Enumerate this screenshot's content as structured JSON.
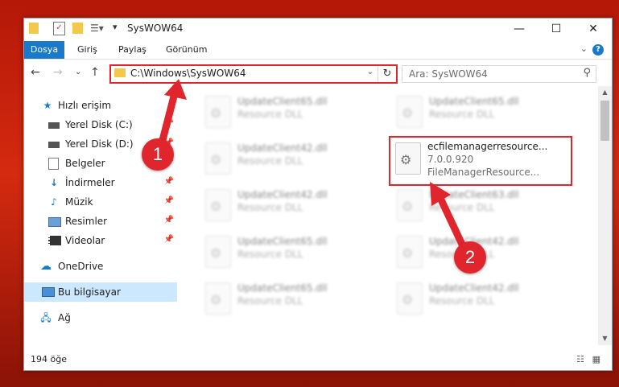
{
  "window": {
    "title": "SysWOW64",
    "controls": {
      "minimize": "—",
      "maximize": "☐",
      "close": "✕"
    }
  },
  "ribbon": {
    "tabs": [
      "Dosya",
      "Giriş",
      "Paylaş",
      "Görünüm"
    ],
    "help": "?"
  },
  "address": {
    "path": "C:\\Windows\\SysWOW64"
  },
  "search": {
    "placeholder": "Ara: SysWOW64"
  },
  "nav": {
    "items": [
      {
        "label": "Hızlı erişim",
        "icon": "star-icon"
      },
      {
        "label": "Yerel Disk (C:)",
        "icon": "drive-icon"
      },
      {
        "label": "Yerel Disk (D:)",
        "icon": "drive-icon"
      },
      {
        "label": "Belgeler",
        "icon": "documents-icon"
      },
      {
        "label": "İndirmeler",
        "icon": "download-icon"
      },
      {
        "label": "Müzik",
        "icon": "music-icon"
      },
      {
        "label": "Resimler",
        "icon": "pictures-icon"
      },
      {
        "label": "Videolar",
        "icon": "videos-icon"
      },
      {
        "label": "OneDrive",
        "icon": "cloud-icon"
      },
      {
        "label": "Bu bilgisayar",
        "icon": "computer-icon"
      },
      {
        "label": "Ağ",
        "icon": "network-icon"
      }
    ]
  },
  "files": {
    "items": [
      {
        "name": "UpdateClient65.dll",
        "type": "Resource DLL"
      },
      {
        "name": "UpdateClient65.dll",
        "type": "Resource DLL"
      },
      {
        "name": "UpdateClient42.dll",
        "type": "Resource DLL"
      },
      {
        "name": "ecfilemanagerresource...",
        "version": "7.0.0.920",
        "desc": "FileManagerResource..."
      },
      {
        "name": "UpdateClient42.dll",
        "type": "Resource DLL"
      },
      {
        "name": "UpdateClient63.dll",
        "type": "Resource DLL"
      },
      {
        "name": "UpdateClient65.dll",
        "type": "Resource DLL"
      },
      {
        "name": "UpdateClient42.dll",
        "type": "Resource DLL"
      },
      {
        "name": "UpdateClient65.dll",
        "type": "Resource DLL"
      },
      {
        "name": "UpdateClient42.dll",
        "type": "Resource DLL"
      }
    ]
  },
  "status": {
    "count": "194 öğe"
  },
  "annotations": {
    "step1": "1",
    "step2": "2",
    "color": "#e0262c"
  }
}
